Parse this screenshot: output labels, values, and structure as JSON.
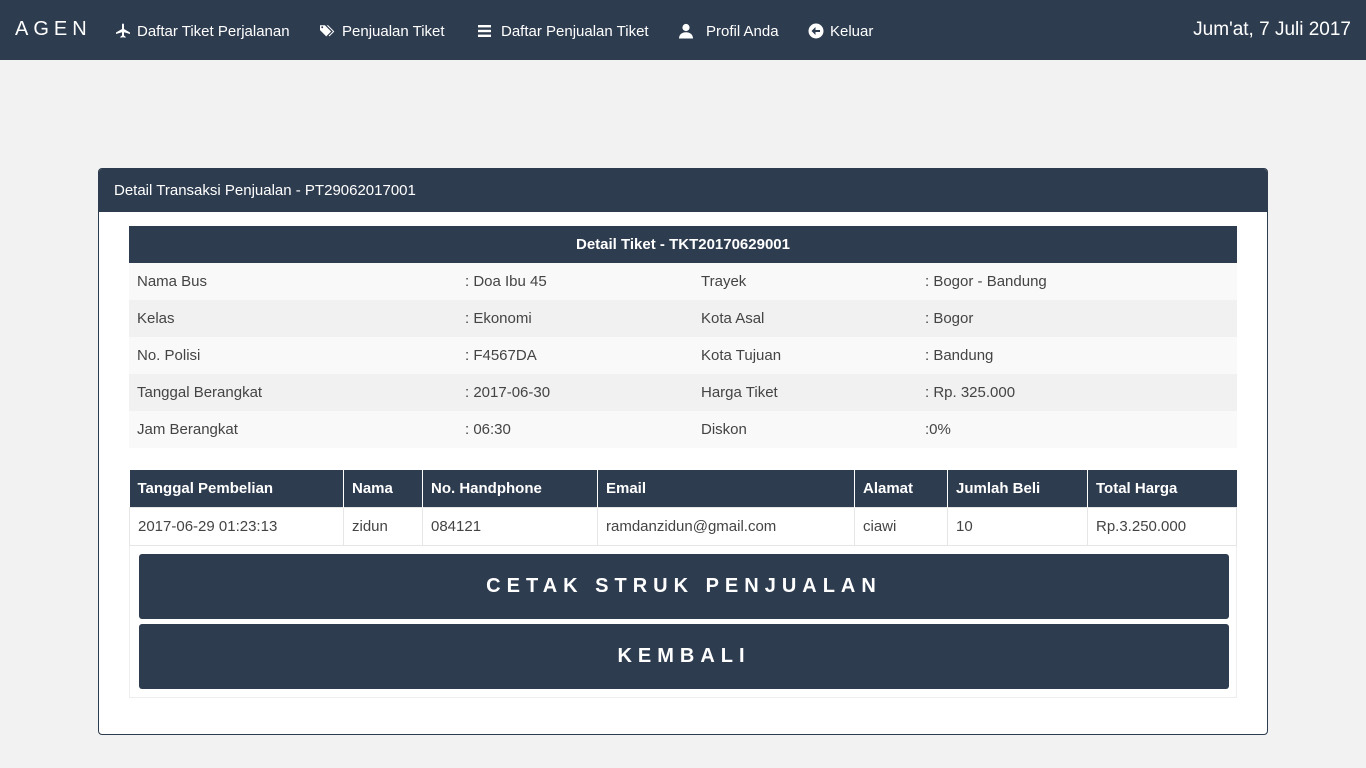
{
  "navbar": {
    "brand": "AGEN",
    "items": [
      {
        "label": "Daftar Tiket Perjalanan",
        "icon": "plane-icon"
      },
      {
        "label": "Penjualan Tiket",
        "icon": "tags-icon"
      },
      {
        "label": "Daftar Penjualan Tiket",
        "icon": "list-icon"
      },
      {
        "label": "Profil Anda",
        "icon": "user-icon"
      },
      {
        "label": "Keluar",
        "icon": "circle-arrow-icon"
      }
    ],
    "date": "Jum'at, 7 Juli 2017"
  },
  "panel": {
    "title": "Detail Transaksi Penjualan - PT29062017001"
  },
  "ticket": {
    "title": "Detail Tiket - TKT20170629001",
    "rows": [
      {
        "label1": "Nama Bus",
        "value1": ": Doa Ibu 45",
        "label2": "Trayek",
        "value2": ": Bogor - Bandung"
      },
      {
        "label1": "Kelas",
        "value1": ": Ekonomi",
        "label2": "Kota Asal",
        "value2": ": Bogor"
      },
      {
        "label1": "No. Polisi",
        "value1": ": F4567DA",
        "label2": "Kota Tujuan",
        "value2": ": Bandung"
      },
      {
        "label1": "Tanggal Berangkat",
        "value1": ": 2017-06-30",
        "label2": "Harga Tiket",
        "value2": ": Rp. 325.000"
      },
      {
        "label1": "Jam Berangkat",
        "value1": ": 06:30",
        "label2": "Diskon",
        "value2": ":0%"
      }
    ]
  },
  "sales": {
    "headers": [
      "Tanggal Pembelian",
      "Nama",
      "No. Handphone",
      "Email",
      "Alamat",
      "Jumlah Beli",
      "Total Harga"
    ],
    "rows": [
      [
        "2017-06-29 01:23:13",
        "zidun",
        "084121",
        "ramdanzidun@gmail.com",
        "ciawi",
        "10",
        "Rp.3.250.000"
      ]
    ]
  },
  "buttons": {
    "print": "CETAK STRUK PENJUALAN",
    "back": "KEMBALI"
  },
  "colors": {
    "primary": "#2e3c4f",
    "background": "#f2f2f2"
  }
}
